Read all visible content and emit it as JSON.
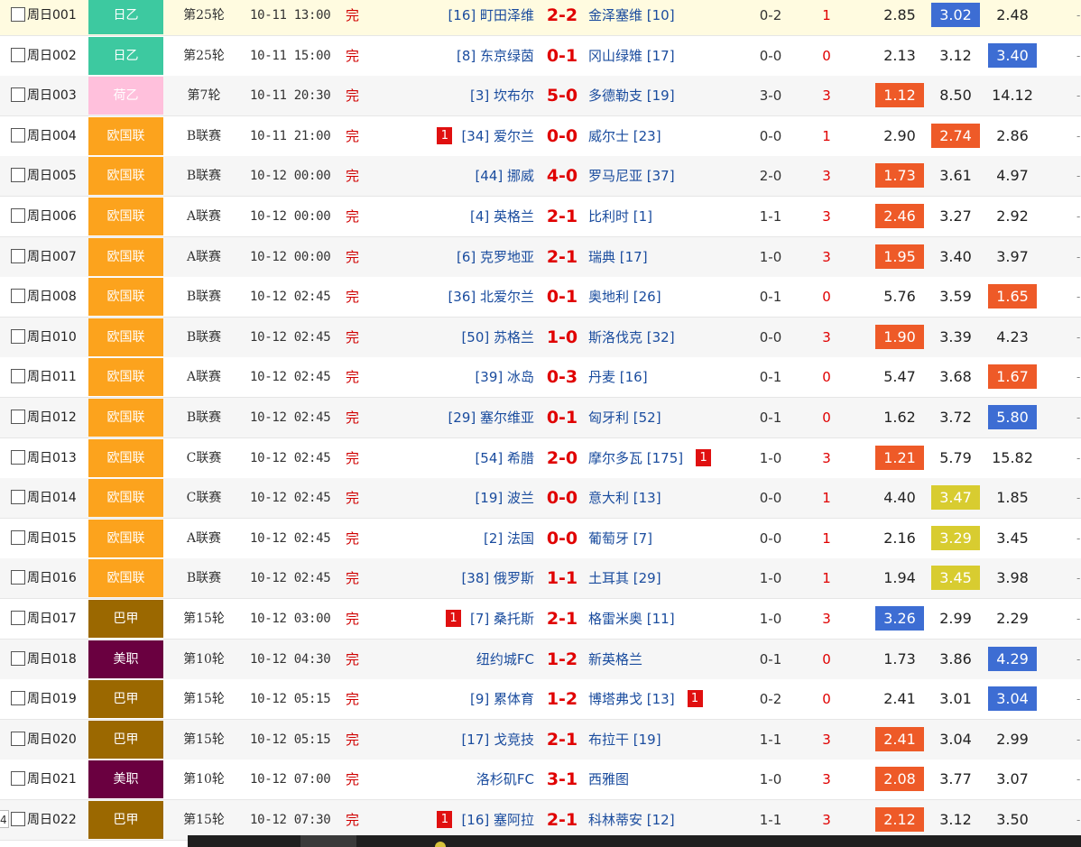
{
  "colors": {
    "league_japan": "#3dc9a0",
    "league_netherlands": "#ffc0dc",
    "league_nations": "#fca31d",
    "league_brazil": "#9b6800",
    "league_mls": "#6a0040",
    "odd_red": "#ee5a28",
    "odd_blue": "#3d6dd3",
    "odd_yellow": "#d8cc30",
    "row_highlight": "#fffbe0",
    "row_alt": "#f6f6f6"
  },
  "page_number": "4",
  "matches": [
    {
      "num": "周日001",
      "league": "日乙",
      "league_color": "#3dc9a0",
      "round": "第25轮",
      "time": "10-11 13:00",
      "status": "完",
      "home": "[16] 町田泽维",
      "score": "2-2",
      "away": "金泽塞维 [10]",
      "half": "0-2",
      "result": "1",
      "odds": [
        "2.85",
        "3.02",
        "2.48"
      ],
      "hl": [
        null,
        "#3d6dd3",
        null
      ],
      "home_red": "",
      "away_red": "",
      "bg": "#fffbe0"
    },
    {
      "num": "周日002",
      "league": "日乙",
      "league_color": "#3dc9a0",
      "round": "第25轮",
      "time": "10-11 15:00",
      "status": "完",
      "home": "[8] 东京绿茵",
      "score": "0-1",
      "away": "冈山绿雉 [17]",
      "half": "0-0",
      "result": "0",
      "odds": [
        "2.13",
        "3.12",
        "3.40"
      ],
      "hl": [
        null,
        null,
        "#3d6dd3"
      ],
      "home_red": "",
      "away_red": "",
      "bg": "#ffffff"
    },
    {
      "num": "周日003",
      "league": "荷乙",
      "league_color": "#ffc0dc",
      "round": "第7轮",
      "time": "10-11 20:30",
      "status": "完",
      "home": "[3] 坎布尔",
      "score": "5-0",
      "away": "多德勒支 [19]",
      "half": "3-0",
      "result": "3",
      "odds": [
        "1.12",
        "8.50",
        "14.12"
      ],
      "hl": [
        "#ee5a28",
        null,
        null
      ],
      "home_red": "",
      "away_red": "",
      "bg": "#f6f6f6"
    },
    {
      "num": "周日004",
      "league": "欧国联",
      "league_color": "#fca31d",
      "round": "B联赛",
      "time": "10-11 21:00",
      "status": "完",
      "home": "[34] 爱尔兰",
      "score": "0-0",
      "away": "威尔士 [23]",
      "half": "0-0",
      "result": "1",
      "odds": [
        "2.90",
        "2.74",
        "2.86"
      ],
      "hl": [
        null,
        "#ee5a28",
        null
      ],
      "home_red": "1",
      "away_red": "",
      "bg": "#ffffff"
    },
    {
      "num": "周日005",
      "league": "欧国联",
      "league_color": "#fca31d",
      "round": "B联赛",
      "time": "10-12 00:00",
      "status": "完",
      "home": "[44] 挪威",
      "score": "4-0",
      "away": "罗马尼亚 [37]",
      "half": "2-0",
      "result": "3",
      "odds": [
        "1.73",
        "3.61",
        "4.97"
      ],
      "hl": [
        "#ee5a28",
        null,
        null
      ],
      "home_red": "",
      "away_red": "",
      "bg": "#f6f6f6"
    },
    {
      "num": "周日006",
      "league": "欧国联",
      "league_color": "#fca31d",
      "round": "A联赛",
      "time": "10-12 00:00",
      "status": "完",
      "home": "[4] 英格兰",
      "score": "2-1",
      "away": "比利时 [1]",
      "half": "1-1",
      "result": "3",
      "odds": [
        "2.46",
        "3.27",
        "2.92"
      ],
      "hl": [
        "#ee5a28",
        null,
        null
      ],
      "home_red": "",
      "away_red": "",
      "bg": "#ffffff"
    },
    {
      "num": "周日007",
      "league": "欧国联",
      "league_color": "#fca31d",
      "round": "A联赛",
      "time": "10-12 00:00",
      "status": "完",
      "home": "[6] 克罗地亚",
      "score": "2-1",
      "away": "瑞典 [17]",
      "half": "1-0",
      "result": "3",
      "odds": [
        "1.95",
        "3.40",
        "3.97"
      ],
      "hl": [
        "#ee5a28",
        null,
        null
      ],
      "home_red": "",
      "away_red": "",
      "bg": "#f6f6f6"
    },
    {
      "num": "周日008",
      "league": "欧国联",
      "league_color": "#fca31d",
      "round": "B联赛",
      "time": "10-12 02:45",
      "status": "完",
      "home": "[36] 北爱尔兰",
      "score": "0-1",
      "away": "奥地利 [26]",
      "half": "0-1",
      "result": "0",
      "odds": [
        "5.76",
        "3.59",
        "1.65"
      ],
      "hl": [
        null,
        null,
        "#ee5a28"
      ],
      "home_red": "",
      "away_red": "",
      "bg": "#ffffff"
    },
    {
      "num": "周日010",
      "league": "欧国联",
      "league_color": "#fca31d",
      "round": "B联赛",
      "time": "10-12 02:45",
      "status": "完",
      "home": "[50] 苏格兰",
      "score": "1-0",
      "away": "斯洛伐克 [32]",
      "half": "0-0",
      "result": "3",
      "odds": [
        "1.90",
        "3.39",
        "4.23"
      ],
      "hl": [
        "#ee5a28",
        null,
        null
      ],
      "home_red": "",
      "away_red": "",
      "bg": "#f6f6f6"
    },
    {
      "num": "周日011",
      "league": "欧国联",
      "league_color": "#fca31d",
      "round": "A联赛",
      "time": "10-12 02:45",
      "status": "完",
      "home": "[39] 冰岛",
      "score": "0-3",
      "away": "丹麦 [16]",
      "half": "0-1",
      "result": "0",
      "odds": [
        "5.47",
        "3.68",
        "1.67"
      ],
      "hl": [
        null,
        null,
        "#ee5a28"
      ],
      "home_red": "",
      "away_red": "",
      "bg": "#ffffff"
    },
    {
      "num": "周日012",
      "league": "欧国联",
      "league_color": "#fca31d",
      "round": "B联赛",
      "time": "10-12 02:45",
      "status": "完",
      "home": "[29] 塞尔维亚",
      "score": "0-1",
      "away": "匈牙利 [52]",
      "half": "0-1",
      "result": "0",
      "odds": [
        "1.62",
        "3.72",
        "5.80"
      ],
      "hl": [
        null,
        null,
        "#3d6dd3"
      ],
      "home_red": "",
      "away_red": "",
      "bg": "#f6f6f6"
    },
    {
      "num": "周日013",
      "league": "欧国联",
      "league_color": "#fca31d",
      "round": "C联赛",
      "time": "10-12 02:45",
      "status": "完",
      "home": "[54] 希腊",
      "score": "2-0",
      "away": "摩尔多瓦 [175]",
      "half": "1-0",
      "result": "3",
      "odds": [
        "1.21",
        "5.79",
        "15.82"
      ],
      "hl": [
        "#ee5a28",
        null,
        null
      ],
      "home_red": "",
      "away_red": "1",
      "bg": "#ffffff"
    },
    {
      "num": "周日014",
      "league": "欧国联",
      "league_color": "#fca31d",
      "round": "C联赛",
      "time": "10-12 02:45",
      "status": "完",
      "home": "[19] 波兰",
      "score": "0-0",
      "away": "意大利 [13]",
      "half": "0-0",
      "result": "1",
      "odds": [
        "4.40",
        "3.47",
        "1.85"
      ],
      "hl": [
        null,
        "#d8cc30",
        null
      ],
      "home_red": "",
      "away_red": "",
      "bg": "#f6f6f6"
    },
    {
      "num": "周日015",
      "league": "欧国联",
      "league_color": "#fca31d",
      "round": "A联赛",
      "time": "10-12 02:45",
      "status": "完",
      "home": "[2] 法国",
      "score": "0-0",
      "away": "葡萄牙 [7]",
      "half": "0-0",
      "result": "1",
      "odds": [
        "2.16",
        "3.29",
        "3.45"
      ],
      "hl": [
        null,
        "#d8cc30",
        null
      ],
      "home_red": "",
      "away_red": "",
      "bg": "#ffffff"
    },
    {
      "num": "周日016",
      "league": "欧国联",
      "league_color": "#fca31d",
      "round": "B联赛",
      "time": "10-12 02:45",
      "status": "完",
      "home": "[38] 俄罗斯",
      "score": "1-1",
      "away": "土耳其 [29]",
      "half": "1-0",
      "result": "1",
      "odds": [
        "1.94",
        "3.45",
        "3.98"
      ],
      "hl": [
        null,
        "#d8cc30",
        null
      ],
      "home_red": "",
      "away_red": "",
      "bg": "#f6f6f6"
    },
    {
      "num": "周日017",
      "league": "巴甲",
      "league_color": "#9b6800",
      "round": "第15轮",
      "time": "10-12 03:00",
      "status": "完",
      "home": "[7] 桑托斯",
      "score": "2-1",
      "away": "格雷米奥 [11]",
      "half": "1-0",
      "result": "3",
      "odds": [
        "3.26",
        "2.99",
        "2.29"
      ],
      "hl": [
        "#3d6dd3",
        null,
        null
      ],
      "home_red": "1",
      "away_red": "",
      "bg": "#ffffff"
    },
    {
      "num": "周日018",
      "league": "美职",
      "league_color": "#6a0040",
      "round": "第10轮",
      "time": "10-12 04:30",
      "status": "完",
      "home": "纽约城FC",
      "score": "1-2",
      "away": "新英格兰",
      "half": "0-1",
      "result": "0",
      "odds": [
        "1.73",
        "3.86",
        "4.29"
      ],
      "hl": [
        null,
        null,
        "#3d6dd3"
      ],
      "home_red": "",
      "away_red": "",
      "bg": "#f6f6f6"
    },
    {
      "num": "周日019",
      "league": "巴甲",
      "league_color": "#9b6800",
      "round": "第15轮",
      "time": "10-12 05:15",
      "status": "完",
      "home": "[9] 累体育",
      "score": "1-2",
      "away": "博塔弗戈 [13]",
      "half": "0-2",
      "result": "0",
      "odds": [
        "2.41",
        "3.01",
        "3.04"
      ],
      "hl": [
        null,
        null,
        "#3d6dd3"
      ],
      "home_red": "",
      "away_red": "1",
      "bg": "#ffffff"
    },
    {
      "num": "周日020",
      "league": "巴甲",
      "league_color": "#9b6800",
      "round": "第15轮",
      "time": "10-12 05:15",
      "status": "完",
      "home": "[17] 戈竞技",
      "score": "2-1",
      "away": "布拉干 [19]",
      "half": "1-1",
      "result": "3",
      "odds": [
        "2.41",
        "3.04",
        "2.99"
      ],
      "hl": [
        "#ee5a28",
        null,
        null
      ],
      "home_red": "",
      "away_red": "",
      "bg": "#f6f6f6"
    },
    {
      "num": "周日021",
      "league": "美职",
      "league_color": "#6a0040",
      "round": "第10轮",
      "time": "10-12 07:00",
      "status": "完",
      "home": "洛杉矶FC",
      "score": "3-1",
      "away": "西雅图",
      "half": "1-0",
      "result": "3",
      "odds": [
        "2.08",
        "3.77",
        "3.07"
      ],
      "hl": [
        "#ee5a28",
        null,
        null
      ],
      "home_red": "",
      "away_red": "",
      "bg": "#ffffff"
    },
    {
      "num": "周日022",
      "league": "巴甲",
      "league_color": "#9b6800",
      "round": "第15轮",
      "time": "10-12 07:30",
      "status": "完",
      "home": "[16] 塞阿拉",
      "score": "2-1",
      "away": "科林蒂安 [12]",
      "half": "1-1",
      "result": "3",
      "odds": [
        "2.12",
        "3.12",
        "3.50"
      ],
      "hl": [
        "#ee5a28",
        null,
        null
      ],
      "home_red": "1",
      "away_red": "",
      "bg": "#f6f6f6"
    }
  ]
}
